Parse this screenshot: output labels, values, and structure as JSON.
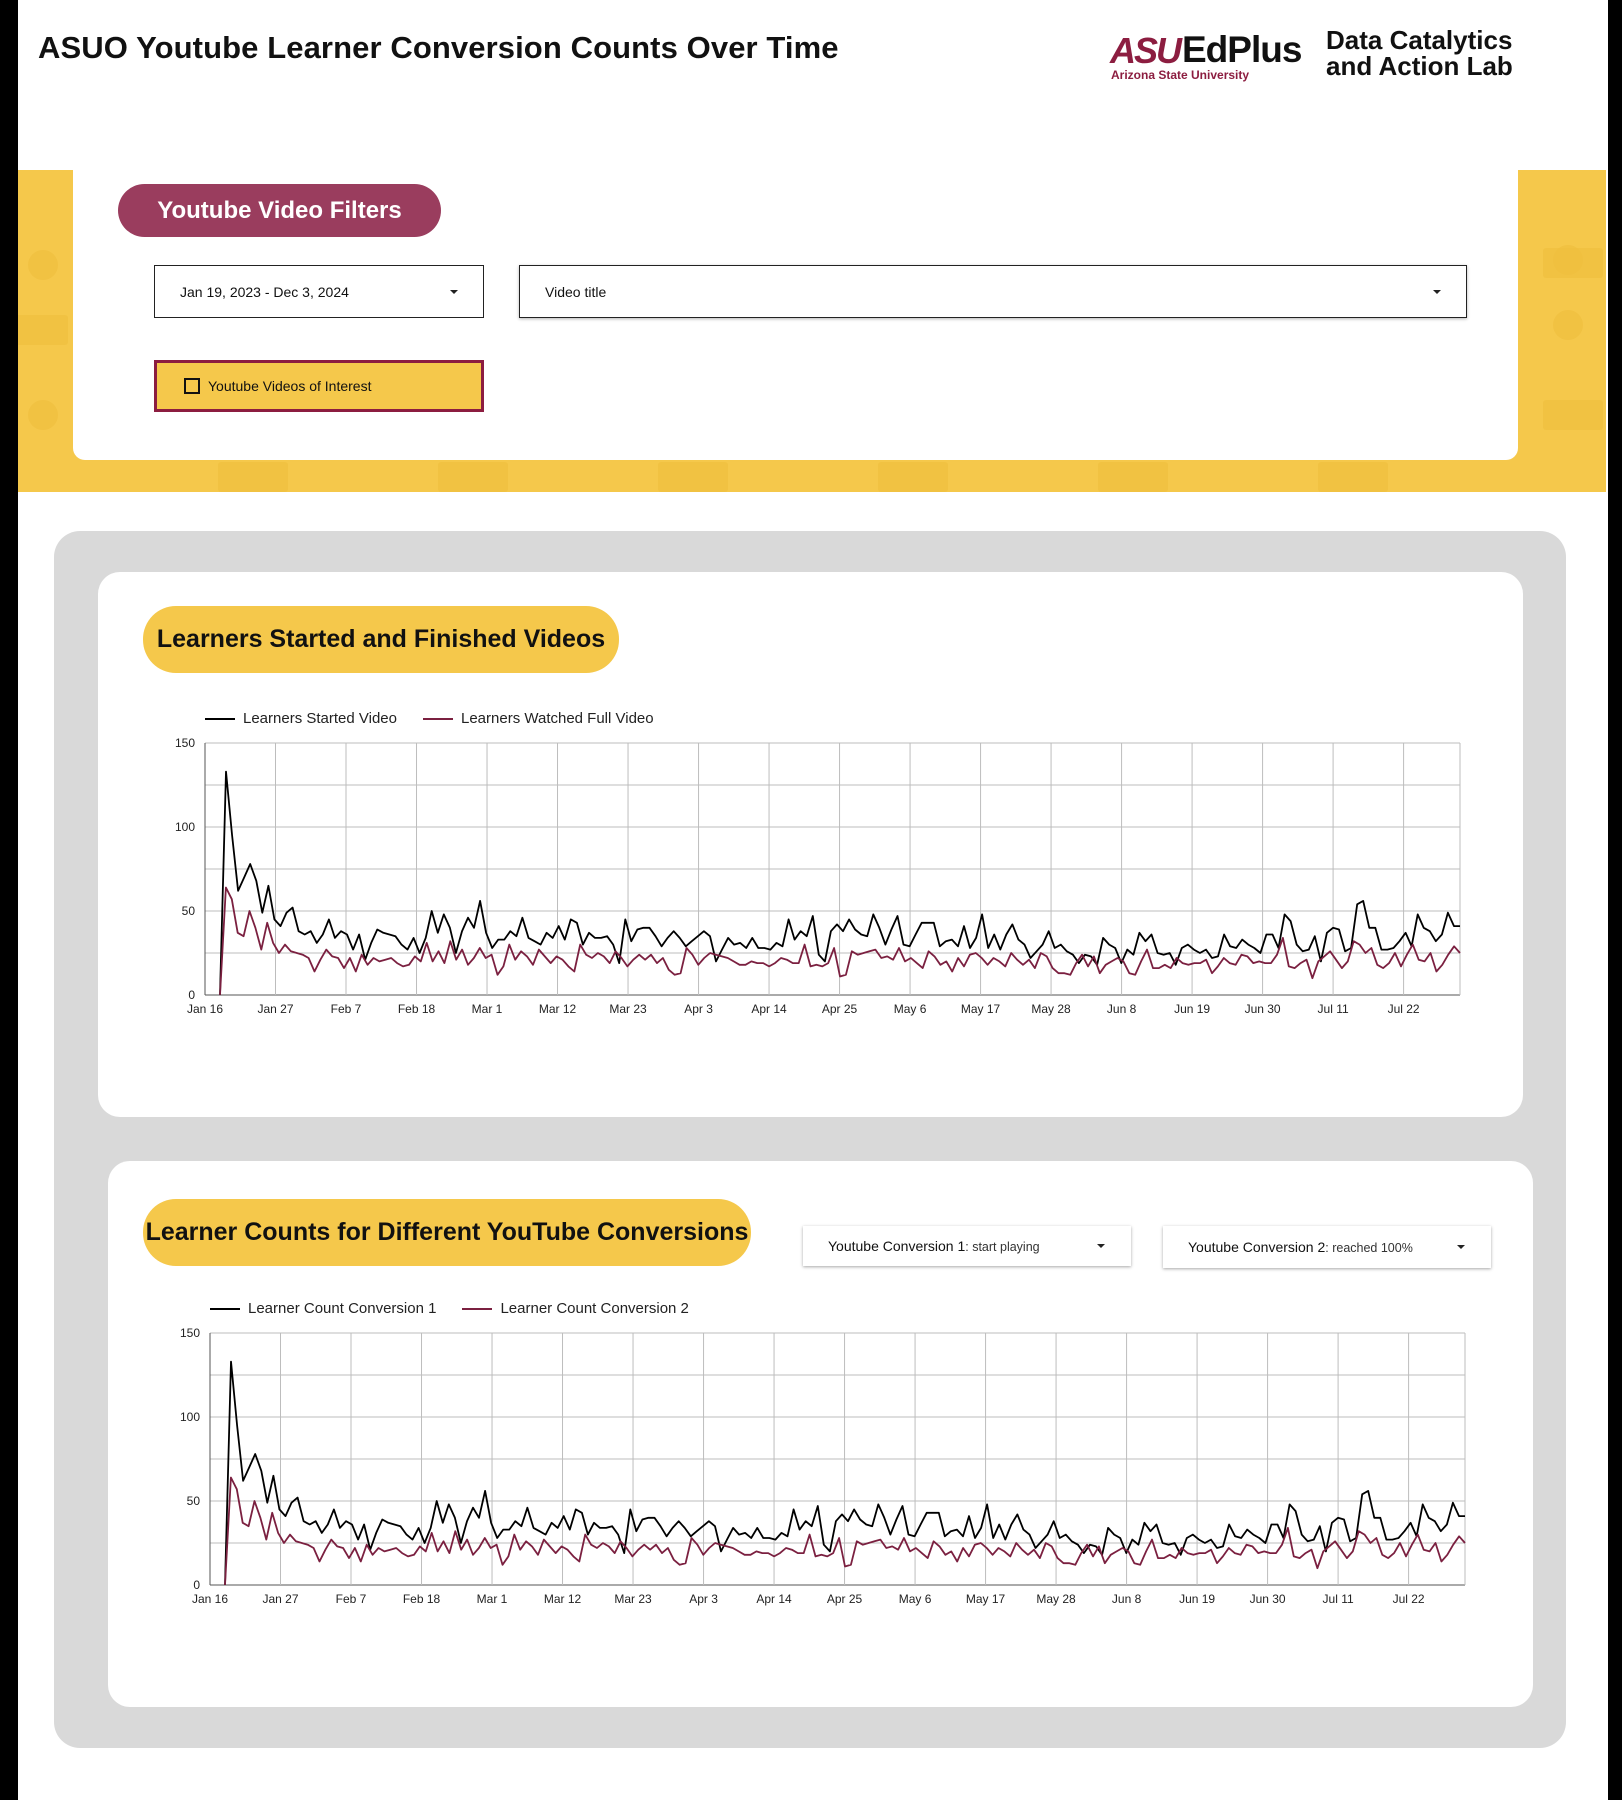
{
  "header": {
    "title": "ASUO Youtube Learner Conversion Counts Over Time",
    "logo": {
      "asu": "ASU",
      "edplus": "EdPlus",
      "asu_sub": "Arizona State University",
      "lab_line1": "Data Catalytics",
      "lab_line2": "and Action Lab"
    }
  },
  "filters": {
    "section_label": "Youtube Video Filters",
    "date_range": "Jan 19, 2023 - Dec 3, 2024",
    "video_title": "Video title",
    "interest_checkbox": "Youtube Videos of Interest",
    "interest_checked": false
  },
  "colors": {
    "maroon": "#8c1d40",
    "gold": "#f5c84b",
    "pill_maroon": "#9a3d5e",
    "panel_gray": "#d9d9d9",
    "series1": "#000000",
    "series2": "#7b2040"
  },
  "section1": {
    "title": "Learners Started and Finished Videos",
    "legend": [
      "Learners Started Video",
      "Learners Watched Full Video"
    ]
  },
  "section2": {
    "title": "Learner Counts for Different YouTube Conversions",
    "conversion1_label": "Youtube Conversion 1",
    "conversion1_value": ": start playing",
    "conversion2_label": "Youtube Conversion 2",
    "conversion2_value": ": reached 100%",
    "legend": [
      "Learner Count Conversion 1",
      "Learner Count Conversion 2"
    ]
  },
  "chart_data": [
    {
      "type": "line",
      "title": "Learners Started and Finished Videos",
      "x_tick_labels": [
        "Jan 16",
        "Jan 27",
        "Feb 7",
        "Feb 18",
        "Mar 1",
        "Mar 12",
        "Mar 23",
        "Apr 3",
        "Apr 14",
        "Apr 25",
        "May 6",
        "May 17",
        "May 28",
        "Jun 8",
        "Jun 19",
        "Jun 30",
        "Jul 11",
        "Jul 22"
      ],
      "y_ticks": [
        0,
        50,
        100,
        150
      ],
      "ylim": [
        0,
        150
      ],
      "grid": true,
      "legend_position": "top-left",
      "series": [
        {
          "name": "Learners Started Video",
          "values": [
            0,
            133,
            95,
            62,
            70,
            78,
            68,
            49,
            65,
            45,
            41,
            49,
            52,
            38,
            36,
            38,
            31,
            36,
            45,
            34,
            38,
            36,
            27,
            36,
            21,
            31,
            39,
            37,
            36,
            35,
            30,
            27,
            34,
            25,
            34,
            50,
            37,
            48,
            40,
            25,
            38,
            46,
            40,
            56,
            37,
            28,
            33,
            33,
            38,
            35,
            46,
            34,
            32,
            30,
            37,
            34,
            41,
            33,
            45,
            43,
            30,
            37,
            34,
            34,
            35,
            30,
            19,
            45,
            32,
            39,
            40,
            40,
            35,
            29,
            34,
            38,
            34,
            29,
            32,
            35,
            38,
            35,
            20,
            27,
            34,
            30,
            31,
            28,
            34,
            28,
            28,
            27,
            31,
            29,
            45,
            33,
            38,
            35,
            47,
            24,
            20,
            38,
            42,
            38,
            45,
            39,
            36,
            35,
            48,
            40,
            30,
            39,
            47,
            30,
            29,
            36,
            43,
            43,
            43,
            29,
            32,
            33,
            29,
            41,
            28,
            34,
            48,
            28,
            36,
            27,
            36,
            42,
            33,
            30,
            22,
            26,
            30,
            38,
            28,
            30,
            26,
            24,
            19,
            24,
            23,
            18,
            34,
            30,
            28,
            19,
            27,
            24,
            37,
            32,
            36,
            25,
            24,
            25,
            18,
            28,
            30,
            27,
            25,
            27,
            22,
            23,
            36,
            29,
            28,
            33,
            30,
            28,
            25,
            36,
            36,
            28,
            48,
            44,
            30,
            26,
            27,
            35,
            20,
            37,
            40,
            39,
            26,
            28,
            54,
            56,
            40,
            40,
            27,
            27,
            28,
            32,
            37,
            29,
            48,
            40,
            38,
            32,
            36,
            49,
            41,
            41
          ],
          "color": "#000000"
        },
        {
          "name": "Learners Watched Full Video",
          "values": [
            0,
            64,
            57,
            37,
            35,
            50,
            40,
            27,
            43,
            31,
            25,
            30,
            26,
            25,
            24,
            22,
            14,
            21,
            27,
            23,
            22,
            16,
            22,
            14,
            24,
            18,
            22,
            20,
            21,
            22,
            19,
            17,
            18,
            23,
            20,
            31,
            20,
            26,
            19,
            32,
            21,
            27,
            18,
            22,
            28,
            22,
            24,
            12,
            17,
            30,
            21,
            26,
            23,
            18,
            27,
            23,
            19,
            23,
            21,
            17,
            14,
            30,
            24,
            22,
            25,
            23,
            19,
            26,
            22,
            17,
            21,
            24,
            21,
            24,
            19,
            22,
            15,
            12,
            13,
            28,
            24,
            18,
            22,
            25,
            24,
            23,
            22,
            20,
            18,
            18,
            20,
            19,
            19,
            17,
            19,
            22,
            21,
            19,
            19,
            30,
            17,
            18,
            17,
            19,
            28,
            11,
            12,
            26,
            24,
            25,
            26,
            27,
            22,
            23,
            21,
            28,
            20,
            22,
            19,
            16,
            26,
            23,
            18,
            20,
            14,
            22,
            17,
            24,
            25,
            22,
            18,
            22,
            20,
            17,
            25,
            21,
            18,
            21,
            16,
            25,
            23,
            16,
            13,
            13,
            12,
            19,
            24,
            17,
            23,
            13,
            18,
            20,
            22,
            20,
            13,
            12,
            20,
            27,
            16,
            16,
            18,
            16,
            22,
            19,
            18,
            19,
            19,
            21,
            13,
            17,
            22,
            19,
            18,
            24,
            23,
            19,
            20,
            19,
            19,
            24,
            34,
            17,
            16,
            19,
            21,
            10,
            20,
            23,
            26,
            21,
            16,
            20,
            32,
            30,
            25,
            28,
            18,
            16,
            19,
            25,
            17,
            24,
            30,
            21,
            20,
            25,
            14,
            18,
            24,
            29,
            25
          ],
          "color": "#7b2040"
        }
      ]
    },
    {
      "type": "line",
      "title": "Learner Counts for Different YouTube Conversions",
      "x_tick_labels": [
        "Jan 16",
        "Jan 27",
        "Feb 7",
        "Feb 18",
        "Mar 1",
        "Mar 12",
        "Mar 23",
        "Apr 3",
        "Apr 14",
        "Apr 25",
        "May 6",
        "May 17",
        "May 28",
        "Jun 8",
        "Jun 19",
        "Jun 30",
        "Jul 11",
        "Jul 22"
      ],
      "y_ticks": [
        0,
        50,
        100,
        150
      ],
      "ylim": [
        0,
        150
      ],
      "grid": true,
      "legend_position": "top-left",
      "series": [
        {
          "name": "Learner Count Conversion 1",
          "values": [
            0,
            133,
            95,
            62,
            70,
            78,
            68,
            49,
            65,
            45,
            41,
            49,
            52,
            38,
            36,
            38,
            31,
            36,
            45,
            34,
            38,
            36,
            27,
            36,
            21,
            31,
            39,
            37,
            36,
            35,
            30,
            27,
            34,
            25,
            34,
            50,
            37,
            48,
            40,
            25,
            38,
            46,
            40,
            56,
            37,
            28,
            33,
            33,
            38,
            35,
            46,
            34,
            32,
            30,
            37,
            34,
            41,
            33,
            45,
            43,
            30,
            37,
            34,
            34,
            35,
            30,
            19,
            45,
            32,
            39,
            40,
            40,
            35,
            29,
            34,
            38,
            34,
            29,
            32,
            35,
            38,
            35,
            20,
            27,
            34,
            30,
            31,
            28,
            34,
            28,
            28,
            27,
            31,
            29,
            45,
            33,
            38,
            35,
            47,
            24,
            20,
            38,
            42,
            38,
            45,
            39,
            36,
            35,
            48,
            40,
            30,
            39,
            47,
            30,
            29,
            36,
            43,
            43,
            43,
            29,
            32,
            33,
            29,
            41,
            28,
            34,
            48,
            28,
            36,
            27,
            36,
            42,
            33,
            30,
            22,
            26,
            30,
            38,
            28,
            30,
            26,
            24,
            19,
            24,
            23,
            18,
            34,
            30,
            28,
            19,
            27,
            24,
            37,
            32,
            36,
            25,
            24,
            25,
            18,
            28,
            30,
            27,
            25,
            27,
            22,
            23,
            36,
            29,
            28,
            33,
            30,
            28,
            25,
            36,
            36,
            28,
            48,
            44,
            30,
            26,
            27,
            35,
            20,
            37,
            40,
            39,
            26,
            28,
            54,
            56,
            40,
            40,
            27,
            27,
            28,
            32,
            37,
            29,
            48,
            40,
            38,
            32,
            36,
            49,
            41,
            41
          ],
          "color": "#000000"
        },
        {
          "name": "Learner Count Conversion 2",
          "values": [
            0,
            64,
            57,
            37,
            35,
            50,
            40,
            27,
            43,
            31,
            25,
            30,
            26,
            25,
            24,
            22,
            14,
            21,
            27,
            23,
            22,
            16,
            22,
            14,
            24,
            18,
            22,
            20,
            21,
            22,
            19,
            17,
            18,
            23,
            20,
            31,
            20,
            26,
            19,
            32,
            21,
            27,
            18,
            22,
            28,
            22,
            24,
            12,
            17,
            30,
            21,
            26,
            23,
            18,
            27,
            23,
            19,
            23,
            21,
            17,
            14,
            30,
            24,
            22,
            25,
            23,
            19,
            26,
            22,
            17,
            21,
            24,
            21,
            24,
            19,
            22,
            15,
            12,
            13,
            28,
            24,
            18,
            22,
            25,
            24,
            23,
            22,
            20,
            18,
            18,
            20,
            19,
            19,
            17,
            19,
            22,
            21,
            19,
            19,
            30,
            17,
            18,
            17,
            19,
            28,
            11,
            12,
            26,
            24,
            25,
            26,
            27,
            22,
            23,
            21,
            28,
            20,
            22,
            19,
            16,
            26,
            23,
            18,
            20,
            14,
            22,
            17,
            24,
            25,
            22,
            18,
            22,
            20,
            17,
            25,
            21,
            18,
            21,
            16,
            25,
            23,
            16,
            13,
            13,
            12,
            19,
            24,
            17,
            23,
            13,
            18,
            20,
            22,
            20,
            13,
            12,
            20,
            27,
            16,
            16,
            18,
            16,
            22,
            19,
            18,
            19,
            19,
            21,
            13,
            17,
            22,
            19,
            18,
            24,
            23,
            19,
            20,
            19,
            19,
            24,
            34,
            17,
            16,
            19,
            21,
            10,
            20,
            23,
            26,
            21,
            16,
            20,
            32,
            30,
            25,
            28,
            18,
            16,
            19,
            25,
            17,
            24,
            30,
            21,
            20,
            25,
            14,
            18,
            24,
            29,
            25
          ],
          "color": "#7b2040"
        }
      ]
    }
  ]
}
